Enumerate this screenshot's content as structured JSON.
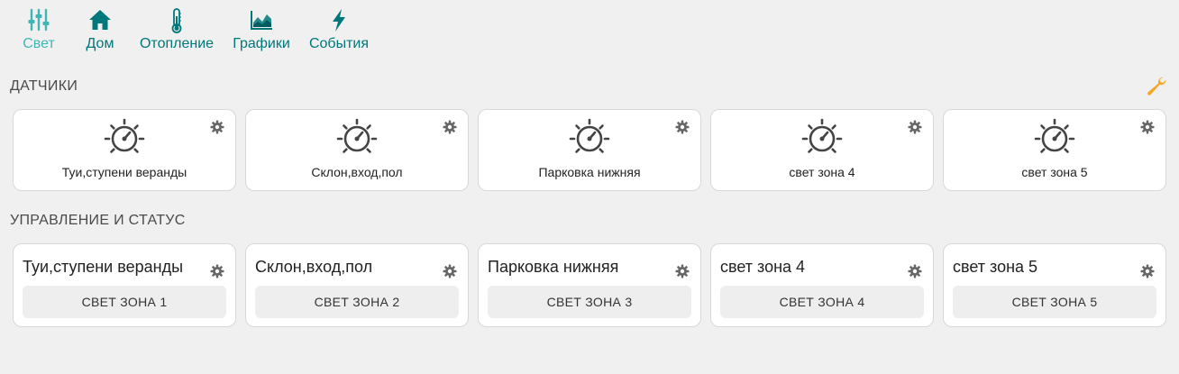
{
  "nav": {
    "items": [
      {
        "label": "Свет",
        "icon": "sliders-icon",
        "active": true
      },
      {
        "label": "Дом",
        "icon": "home-icon",
        "active": false
      },
      {
        "label": "Отопление",
        "icon": "thermometer-icon",
        "active": false
      },
      {
        "label": "Графики",
        "icon": "chart-icon",
        "active": false
      },
      {
        "label": "События",
        "icon": "lightning-icon",
        "active": false
      }
    ]
  },
  "sensors": {
    "title": "ДАТЧИКИ",
    "settings_icon": "wrench-icon",
    "items": [
      {
        "name": "Туи,ступени веранды"
      },
      {
        "name": "Склон,вход,пол"
      },
      {
        "name": "Парковка нижняя"
      },
      {
        "name": "свет зона 4"
      },
      {
        "name": "свет зона 5"
      }
    ]
  },
  "controls": {
    "title": "УПРАВЛЕНИЕ И СТАТУС",
    "items": [
      {
        "title": "Туи,ступени веранды",
        "button": "СВЕТ ЗОНА 1"
      },
      {
        "title": "Склон,вход,пол",
        "button": "СВЕТ ЗОНА 2"
      },
      {
        "title": "Парковка нижняя",
        "button": "СВЕТ ЗОНА 3"
      },
      {
        "title": "свет зона 4",
        "button": "СВЕТ ЗОНА 4"
      },
      {
        "title": "свет зона 5",
        "button": "СВЕТ ЗОНА 5"
      }
    ]
  },
  "colors": {
    "nav_active": "#3fb6b4",
    "nav": "#00777a",
    "wrench": "#f5a623",
    "background": "#f0f0f0"
  }
}
